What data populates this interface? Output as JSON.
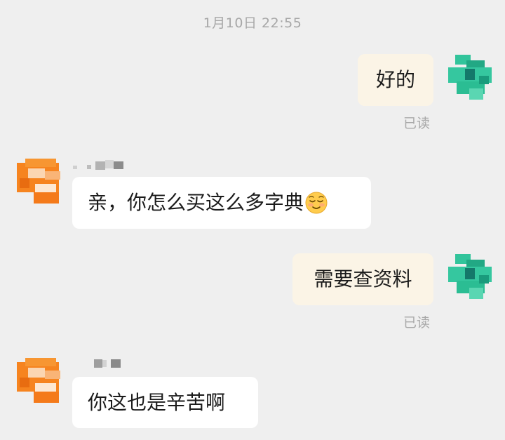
{
  "chat": {
    "timestamp": "1月10日 22:55",
    "messages": [
      {
        "side": "out",
        "text": "好的",
        "status": "已读"
      },
      {
        "side": "in",
        "text": "亲，你怎么买这么多字典",
        "emoji": "relieved-face-emoji"
      },
      {
        "side": "out",
        "text": "需要查资料",
        "status": "已读"
      },
      {
        "side": "in",
        "text": "你这也是辛苦啊"
      }
    ]
  },
  "colors": {
    "background": "#efefef",
    "outgoing_bubble": "#fbf4e6",
    "incoming_bubble": "#ffffff",
    "meta_text": "#a7a7a7",
    "self_avatar": "#2fc29a",
    "contact_avatar": "#f58220"
  },
  "icons": {
    "self_avatar": "pixelated-green-avatar-icon",
    "contact_avatar": "pixelated-orange-avatar-icon",
    "contact_name": "pixelated-contact-name"
  }
}
